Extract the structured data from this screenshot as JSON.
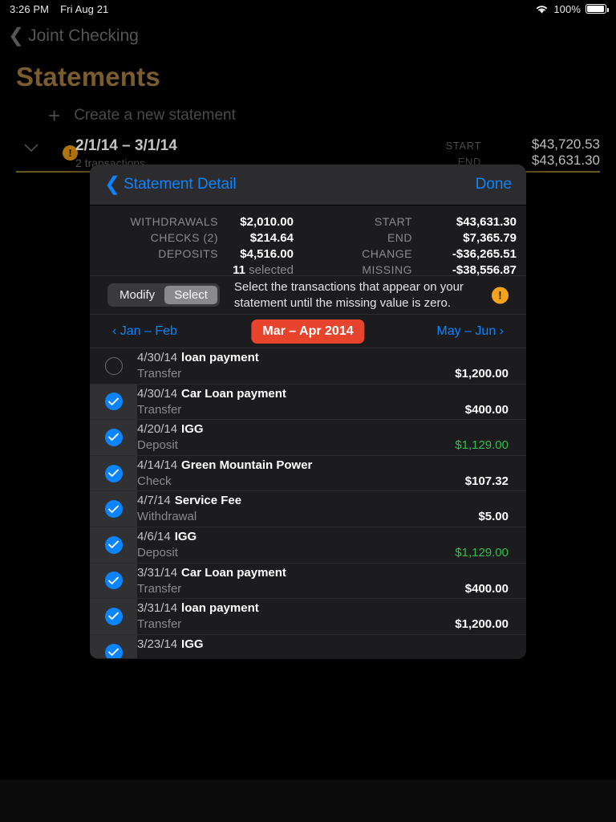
{
  "status_bar": {
    "time": "3:26 PM",
    "date": "Fri Aug 21",
    "battery_percent": "100%",
    "wifi_icon": "wifi-icon",
    "battery_icon": "battery-full-icon"
  },
  "backdrop": {
    "back_label": "Joint Checking",
    "back_chevron": "chevron-left-icon",
    "page_title": "Statements",
    "create_label": "Create a new statement",
    "create_icon": "plus-icon",
    "statement_row": {
      "disclosure_icon": "chevron-down-icon",
      "warning_icon": "warning-icon",
      "warning_glyph": "!",
      "date_range": "2/1/14 – 3/1/14",
      "subtitle": "2 transactions",
      "start_label": "START",
      "start_value": "$43,720.53",
      "end_label": "END",
      "end_value": "$43,631.30"
    }
  },
  "modal": {
    "header": {
      "back_chevron": "chevron-left-icon",
      "back_label": "Statement Detail",
      "done_label": "Done"
    },
    "summary": {
      "left": [
        {
          "label": "WITHDRAWALS",
          "value": "$2,010.00"
        },
        {
          "label": "CHECKS (2)",
          "value": "$214.64"
        },
        {
          "label": "DEPOSITS",
          "value": "$4,516.00"
        }
      ],
      "selected_count": "11",
      "selected_suffix": " selected",
      "right": [
        {
          "label": "START",
          "value": "$43,631.30"
        },
        {
          "label": "END",
          "value": "$7,365.79"
        },
        {
          "label": "CHANGE",
          "value": "-$36,265.51"
        },
        {
          "label": "MISSING",
          "value": "-$38,556.87"
        }
      ]
    },
    "select_bar": {
      "modify_label": "Modify",
      "select_label": "Select",
      "active_segment": "Select",
      "hint": "Select the transactions that appear on your statement until the missing value is zero.",
      "warning_icon": "warning-icon",
      "warning_glyph": "!",
      "warning_color": "#f6a21a"
    },
    "period_nav": {
      "prev_label": "‹ Jan – Feb",
      "current_label": "Mar – Apr 2014",
      "next_label": "May – Jun ›",
      "current_color": "#e8432c",
      "link_color": "#0a84ff"
    },
    "transactions": [
      {
        "selected": false,
        "date": "4/30/14",
        "name": "loan payment",
        "type": "Transfer",
        "amount": "$1,200.00",
        "credit": false
      },
      {
        "selected": true,
        "date": "4/30/14",
        "name": "Car  Loan payment",
        "type": "Transfer",
        "amount": "$400.00",
        "credit": false
      },
      {
        "selected": true,
        "date": "4/20/14",
        "name": "IGG",
        "type": "Deposit",
        "amount": "$1,129.00",
        "credit": true
      },
      {
        "selected": true,
        "date": "4/14/14",
        "name": "Green Mountain Power",
        "type": "Check",
        "amount": "$107.32",
        "credit": false
      },
      {
        "selected": true,
        "date": "4/7/14",
        "name": "Service Fee",
        "type": "Withdrawal",
        "amount": "$5.00",
        "credit": false
      },
      {
        "selected": true,
        "date": "4/6/14",
        "name": "IGG",
        "type": "Deposit",
        "amount": "$1,129.00",
        "credit": true
      },
      {
        "selected": true,
        "date": "3/31/14",
        "name": "Car  Loan payment",
        "type": "Transfer",
        "amount": "$400.00",
        "credit": false
      },
      {
        "selected": true,
        "date": "3/31/14",
        "name": "loan payment",
        "type": "Transfer",
        "amount": "$1,200.00",
        "credit": false
      },
      {
        "selected": true,
        "date": "3/23/14",
        "name": "IGG",
        "type": "",
        "amount": "",
        "credit": true
      }
    ]
  }
}
